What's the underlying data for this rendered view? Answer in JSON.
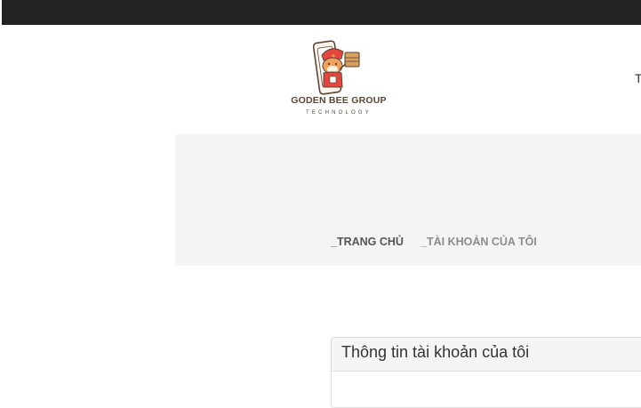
{
  "colors": {
    "topbar": "#232323",
    "banner": "#f4f4f4",
    "brand_brown": "#5a4636",
    "brand_red": "#e2463c"
  },
  "header": {
    "logo": {
      "name": "GODEN BEE GROUP",
      "tagline": "TECHNOLOGY",
      "icon": "mascot-phone-icon"
    },
    "nav_partial": "T"
  },
  "breadcrumb": {
    "home": "_TRANG CHỦ",
    "current": "_TÀI KHOẢN CỦA TÔI"
  },
  "panel": {
    "title": "Thông tin tài khoản của tôi"
  }
}
